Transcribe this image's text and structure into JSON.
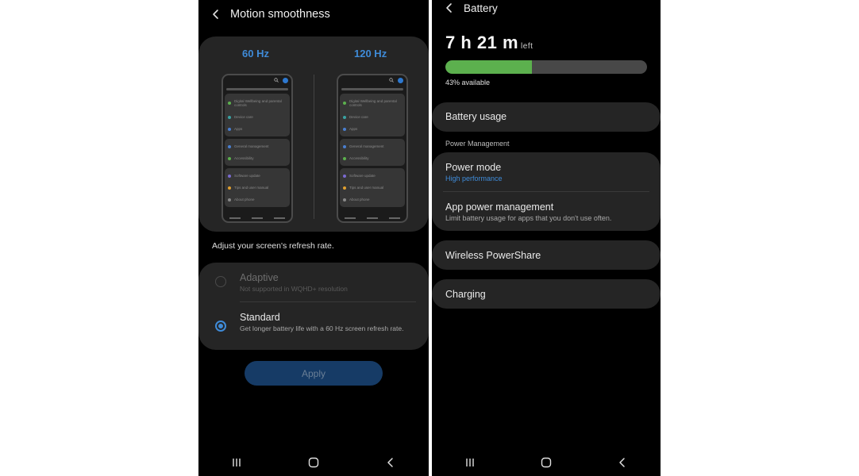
{
  "left": {
    "title": "Motion smoothness",
    "preview": {
      "label_60": "60 Hz",
      "label_120": "120 Hz",
      "mock_items": [
        "Digital Wellbeing and parental controls",
        "Device care",
        "Apps",
        "General management",
        "Accessibility",
        "Software update",
        "Tips and user manual",
        "About phone"
      ]
    },
    "description": "Adjust your screen's refresh rate.",
    "options": [
      {
        "title": "Adaptive",
        "subtitle": "Not supported in WQHD+ resolution",
        "selected": false
      },
      {
        "title": "Standard",
        "subtitle": "Get longer battery life with a 60 Hz screen refresh rate.",
        "selected": true
      }
    ],
    "apply_label": "Apply"
  },
  "right": {
    "title": "Battery",
    "time_remaining": "7 h 21 m",
    "time_suffix": "left",
    "battery_percent": 43,
    "available_text": "43% available",
    "battery_usage": "Battery usage",
    "section_label": "Power Management",
    "power_mode": {
      "title": "Power mode",
      "value": "High performance"
    },
    "app_power": {
      "title": "App power management",
      "subtitle": "Limit battery usage for apps that you don't use often."
    },
    "wireless": "Wireless PowerShare",
    "charging": "Charging"
  },
  "colors": {
    "accent": "#3f8bd8",
    "battery_fill": "#5cb04e",
    "card_bg": "#252525",
    "apply_bg": "#163b66",
    "link_blue": "#3f8bd8"
  },
  "icons": {
    "back": "chevron-left-icon",
    "nav_recents": "recents-icon",
    "nav_home": "home-icon",
    "nav_back": "nav-back-icon"
  }
}
